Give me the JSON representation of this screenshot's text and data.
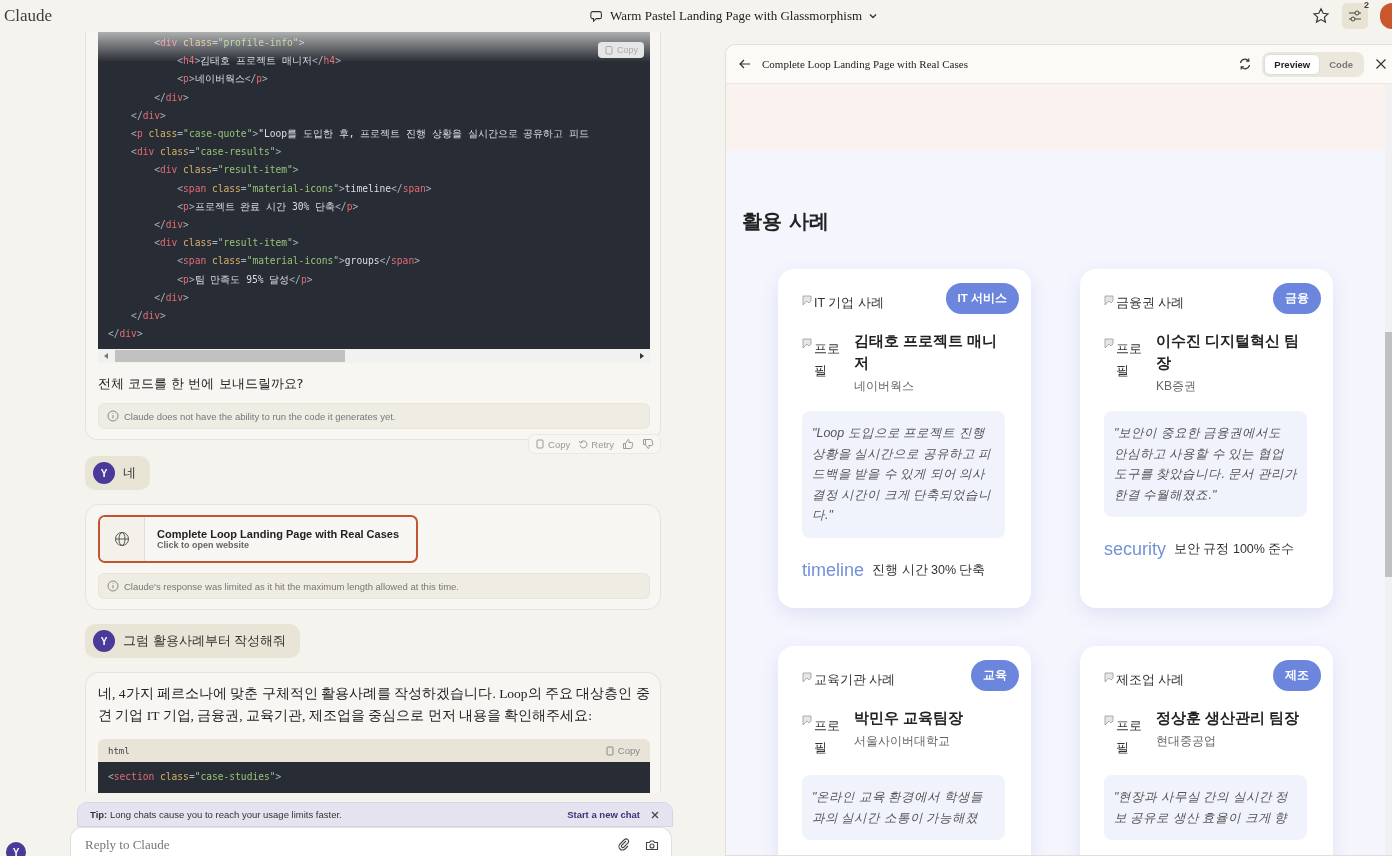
{
  "top_bar": {
    "brand": "Claude",
    "chat_title": "Warm Pastel Landing Page with Glassmorphism",
    "badge": "2"
  },
  "chat": {
    "code_copy": "Copy",
    "code_lines": [
      [
        {
          "kind": "punct",
          "text": "        <"
        },
        {
          "kind": "tag",
          "text": "div"
        },
        {
          "kind": "attr",
          "text": " class"
        },
        {
          "kind": "punct",
          "text": "="
        },
        {
          "kind": "string",
          "text": "\"profile-info\""
        },
        {
          "kind": "punct",
          "text": ">"
        }
      ],
      [
        {
          "kind": "punct",
          "text": "            <"
        },
        {
          "kind": "tag",
          "text": "h4"
        },
        {
          "kind": "punct",
          "text": ">"
        },
        {
          "kind": "content",
          "text": "김태호 프로젝트 매니저"
        },
        {
          "kind": "punct",
          "text": "</"
        },
        {
          "kind": "tag",
          "text": "h4"
        },
        {
          "kind": "punct",
          "text": ">"
        }
      ],
      [
        {
          "kind": "punct",
          "text": "            <"
        },
        {
          "kind": "tag",
          "text": "p"
        },
        {
          "kind": "punct",
          "text": ">"
        },
        {
          "kind": "content",
          "text": "네이버웍스"
        },
        {
          "kind": "punct",
          "text": "</"
        },
        {
          "kind": "tag",
          "text": "p"
        },
        {
          "kind": "punct",
          "text": ">"
        }
      ],
      [
        {
          "kind": "punct",
          "text": "        </"
        },
        {
          "kind": "tag",
          "text": "div"
        },
        {
          "kind": "punct",
          "text": ">"
        }
      ],
      [
        {
          "kind": "punct",
          "text": "    </"
        },
        {
          "kind": "tag",
          "text": "div"
        },
        {
          "kind": "punct",
          "text": ">"
        }
      ],
      [
        {
          "kind": "punct",
          "text": "    <"
        },
        {
          "kind": "tag",
          "text": "p"
        },
        {
          "kind": "attr",
          "text": " class"
        },
        {
          "kind": "punct",
          "text": "="
        },
        {
          "kind": "string",
          "text": "\"case-quote\""
        },
        {
          "kind": "punct",
          "text": ">"
        },
        {
          "kind": "content",
          "text": "\"Loop를 도입한 후, 프로젝트 진행 상황을 실시간으로 공유하고 피드"
        }
      ],
      [
        {
          "kind": "punct",
          "text": "    <"
        },
        {
          "kind": "tag",
          "text": "div"
        },
        {
          "kind": "attr",
          "text": " class"
        },
        {
          "kind": "punct",
          "text": "="
        },
        {
          "kind": "string",
          "text": "\"case-results\""
        },
        {
          "kind": "punct",
          "text": ">"
        }
      ],
      [
        {
          "kind": "punct",
          "text": "        <"
        },
        {
          "kind": "tag",
          "text": "div"
        },
        {
          "kind": "attr",
          "text": " class"
        },
        {
          "kind": "punct",
          "text": "="
        },
        {
          "kind": "string",
          "text": "\"result-item\""
        },
        {
          "kind": "punct",
          "text": ">"
        }
      ],
      [
        {
          "kind": "punct",
          "text": "            <"
        },
        {
          "kind": "tag",
          "text": "span"
        },
        {
          "kind": "attr",
          "text": " class"
        },
        {
          "kind": "punct",
          "text": "="
        },
        {
          "kind": "string",
          "text": "\"material-icons\""
        },
        {
          "kind": "punct",
          "text": ">"
        },
        {
          "kind": "content",
          "text": "timeline"
        },
        {
          "kind": "punct",
          "text": "</"
        },
        {
          "kind": "tag",
          "text": "span"
        },
        {
          "kind": "punct",
          "text": ">"
        }
      ],
      [
        {
          "kind": "punct",
          "text": "            <"
        },
        {
          "kind": "tag",
          "text": "p"
        },
        {
          "kind": "punct",
          "text": ">"
        },
        {
          "kind": "content",
          "text": "프로젝트 완료 시간 30% 단축"
        },
        {
          "kind": "punct",
          "text": "</"
        },
        {
          "kind": "tag",
          "text": "p"
        },
        {
          "kind": "punct",
          "text": ">"
        }
      ],
      [
        {
          "kind": "punct",
          "text": "        </"
        },
        {
          "kind": "tag",
          "text": "div"
        },
        {
          "kind": "punct",
          "text": ">"
        }
      ],
      [
        {
          "kind": "punct",
          "text": "        <"
        },
        {
          "kind": "tag",
          "text": "div"
        },
        {
          "kind": "attr",
          "text": " class"
        },
        {
          "kind": "punct",
          "text": "="
        },
        {
          "kind": "string",
          "text": "\"result-item\""
        },
        {
          "kind": "punct",
          "text": ">"
        }
      ],
      [
        {
          "kind": "punct",
          "text": "            <"
        },
        {
          "kind": "tag",
          "text": "span"
        },
        {
          "kind": "attr",
          "text": " class"
        },
        {
          "kind": "punct",
          "text": "="
        },
        {
          "kind": "string",
          "text": "\"material-icons\""
        },
        {
          "kind": "punct",
          "text": ">"
        },
        {
          "kind": "content",
          "text": "groups"
        },
        {
          "kind": "punct",
          "text": "</"
        },
        {
          "kind": "tag",
          "text": "span"
        },
        {
          "kind": "punct",
          "text": ">"
        }
      ],
      [
        {
          "kind": "punct",
          "text": "            <"
        },
        {
          "kind": "tag",
          "text": "p"
        },
        {
          "kind": "punct",
          "text": ">"
        },
        {
          "kind": "content",
          "text": "팀 만족도 95% 달성"
        },
        {
          "kind": "punct",
          "text": "</"
        },
        {
          "kind": "tag",
          "text": "p"
        },
        {
          "kind": "punct",
          "text": ">"
        }
      ],
      [
        {
          "kind": "punct",
          "text": "        </"
        },
        {
          "kind": "tag",
          "text": "div"
        },
        {
          "kind": "punct",
          "text": ">"
        }
      ],
      [
        {
          "kind": "punct",
          "text": "    </"
        },
        {
          "kind": "tag",
          "text": "div"
        },
        {
          "kind": "punct",
          "text": ">"
        }
      ],
      [
        {
          "kind": "punct",
          "text": "</"
        },
        {
          "kind": "tag",
          "text": "div"
        },
        {
          "kind": "punct",
          "text": ">"
        }
      ]
    ],
    "reply_text": "전체 코드를 한 번에 보내드릴까요?",
    "reply_notice": "Claude does not have the ability to run the code it generates yet.",
    "reply_actions": {
      "copy": "Copy",
      "retry": "Retry"
    },
    "user_messages": [
      {
        "avatar": "Y",
        "text": "네"
      },
      {
        "avatar": "Y",
        "text": "그럼 활용사례부터 작성해줘"
      }
    ],
    "artifact": {
      "title": "Complete Loop Landing Page with Real Cases",
      "subtitle": "Click to open website"
    },
    "artifact_notice": "Claude's response was limited as it hit the maximum length allowed at this time.",
    "answer": {
      "text": "네, 4가지 페르소나에 맞춘 구체적인 활용사례를 작성하겠습니다. Loop의 주요 대상층인 중견 기업 IT 기업, 금융권, 교육기관, 제조업을 중심으로 먼저 내용을 확인해주세요:",
      "code_language": "html",
      "copy": "Copy",
      "code_lines": [
        [
          {
            "kind": "punct",
            "text": "<"
          },
          {
            "kind": "tag",
            "text": "section"
          },
          {
            "kind": "attr",
            "text": " class"
          },
          {
            "kind": "punct",
            "text": "="
          },
          {
            "kind": "string",
            "text": "\"case-studies\""
          },
          {
            "kind": "punct",
            "text": ">"
          }
        ]
      ]
    }
  },
  "tip": {
    "text": "**Tip:** Long chats cause you to reach your usage limits faster.",
    "action": "Start a new chat"
  },
  "composer": {
    "placeholder": "Reply to Claude",
    "avatar": "Y"
  },
  "preview": {
    "title": "Complete Loop Landing Page with Real Cases",
    "tabs": [
      {
        "label": "Preview",
        "selected": true
      },
      {
        "label": "Code",
        "selected": false
      }
    ],
    "section_title": "활용 사례",
    "cards": [
      {
        "image_alt": "IT 기업 사례",
        "badge": "IT 서비스",
        "profile_alt": "프로필",
        "name": "김태호 프로젝트 매니저",
        "company": "네이버웍스",
        "quote": "\"Loop 도입으로 프로젝트 진행 상황을 실시간으로 공유하고 피드백을 받을 수 있게 되어 의사결정 시간이 크게 단축되었습니다.\"",
        "result_icon": "timeline",
        "result": "진행 시간 30% 단축"
      },
      {
        "image_alt": "금융권 사례",
        "badge": "금융",
        "profile_alt": "프로필",
        "name": "이수진 디지털혁신 팀장",
        "company": "KB증권",
        "quote": "\"보안이 중요한 금융권에서도 안심하고 사용할 수 있는 협업 도구를 찾았습니다. 문서 관리가 한결 수월해졌죠.\"",
        "result_icon": "security",
        "result": "보안 규정 100% 준수"
      },
      {
        "image_alt": "교육기관 사례",
        "badge": "교육",
        "profile_alt": "프로필",
        "name": "박민우 교육팀장",
        "company": "서울사이버대학교",
        "quote": "\"온라인 교육 환경에서 학생들과의 실시간 소통이 가능해졌"
      },
      {
        "image_alt": "제조업 사례",
        "badge": "제조",
        "profile_alt": "프로필",
        "name": "정상훈 생산관리 팀장",
        "company": "현대중공업",
        "quote": "\"현장과 사무실 간의 실시간 정보 공유로 생산 효율이 크게 향"
      }
    ]
  }
}
